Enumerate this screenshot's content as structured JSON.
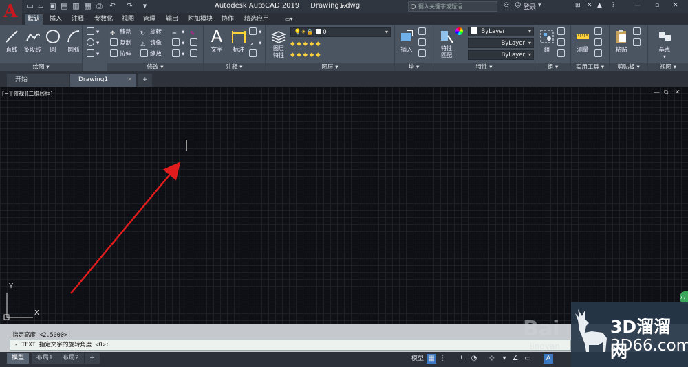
{
  "app": {
    "title": "Autodesk AutoCAD 2019",
    "document": "Drawing1.dwg",
    "logo_letter": "A"
  },
  "search": {
    "placeholder": "键入关键字或短语"
  },
  "account": {
    "login": "登录"
  },
  "ribbon_tabs": [
    "默认",
    "插入",
    "注释",
    "参数化",
    "视图",
    "管理",
    "输出",
    "附加模块",
    "协作",
    "精选应用"
  ],
  "panels": {
    "draw": {
      "title": "绘图",
      "line": "直线",
      "polyline": "多段线",
      "circle": "圆",
      "arc": "圆弧"
    },
    "modify": {
      "title": "修改",
      "move": "移动",
      "rotate": "旋转",
      "copy": "复制",
      "mirror": "镜像",
      "stretch": "拉伸",
      "scale": "缩放"
    },
    "annotation": {
      "title": "注释",
      "text": "文字",
      "dimension": "标注"
    },
    "layers": {
      "title": "图层",
      "props": "图层\n特性",
      "layer_value": "0"
    },
    "block": {
      "title": "块",
      "insert": "插入"
    },
    "properties": {
      "title": "特性",
      "match": "特性\n匹配",
      "color": "ByLayer",
      "linetype": "ByLayer",
      "lineweight": "ByLayer"
    },
    "groups": {
      "title": "组",
      "group": "组"
    },
    "utilities": {
      "title": "实用工具",
      "measure": "测量"
    },
    "clipboard": {
      "title": "剪贴板",
      "paste": "粘贴"
    },
    "view": {
      "title": "视图",
      "base": "基点"
    }
  },
  "doc_tabs": {
    "start": "开始",
    "drawing": "Drawing1"
  },
  "viewport": {
    "label": "[−][俯视][二维线框]"
  },
  "ucs": {
    "x": "X",
    "y": "Y"
  },
  "command": {
    "history": "指定高度 <2.5000>:",
    "prompt": "- TEXT 指定文字的旋转角度 <0>:"
  },
  "layouts": [
    "模型",
    "布局1",
    "布局2"
  ],
  "status": {
    "model": "模型"
  },
  "watermark": {
    "text_cn": "3D溜溜网",
    "text_en": "3D66.com"
  },
  "colors": {
    "arrow": "#e01c1c",
    "autocad_red": "#c8171e",
    "active_tab": "#4a5563"
  }
}
